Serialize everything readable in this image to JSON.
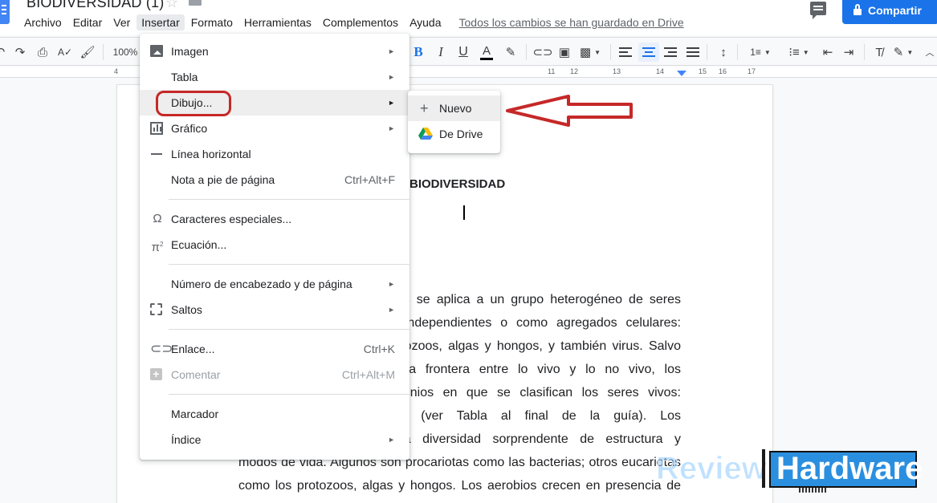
{
  "header": {
    "doc_title": "BIODIVERSIDAD (1)",
    "save_status": "Todos los cambios se han guardado en Drive",
    "share_label": "Compartir",
    "menus": [
      "Archivo",
      "Editar",
      "Ver",
      "Insertar",
      "Formato",
      "Herramientas",
      "Complementos",
      "Ayuda"
    ]
  },
  "toolbar": {
    "zoom": "100%"
  },
  "ruler": {
    "numbers": [
      "4",
      "11",
      "12",
      "13",
      "14",
      "15",
      "16",
      "17"
    ]
  },
  "insert_menu": {
    "items": [
      {
        "label": "Imagen",
        "icon": "image-icon",
        "submenu": true
      },
      {
        "label": "Tabla",
        "submenu": true
      },
      {
        "label": "Dibujo...",
        "submenu": true
      },
      {
        "label": "Gráfico",
        "icon": "chart-icon",
        "submenu": true
      },
      {
        "label": "Línea horizontal",
        "icon": "horizontal-line-icon"
      },
      {
        "label": "Nota a pie de página",
        "shortcut": "Ctrl+Alt+F"
      },
      {
        "label": "Caracteres especiales...",
        "icon": "omega-icon"
      },
      {
        "label": "Ecuación...",
        "icon": "pi-icon"
      },
      {
        "label": "Número de encabezado y de página",
        "submenu": true
      },
      {
        "label": "Saltos",
        "icon": "page-break-icon",
        "submenu": true
      },
      {
        "label": "Enlace...",
        "icon": "link-icon",
        "shortcut": "Ctrl+K"
      },
      {
        "label": "Comentar",
        "icon": "add-comment-icon",
        "shortcut": "Ctrl+Alt+M",
        "disabled": true
      },
      {
        "label": "Marcador"
      },
      {
        "label": "Índice",
        "submenu": true
      }
    ],
    "submenu_arrow": "►"
  },
  "drawing_submenu": {
    "items": [
      {
        "label": "Nuevo",
        "icon": "plus-icon"
      },
      {
        "label": "De Drive",
        "icon": "google-drive-icon"
      }
    ]
  },
  "document": {
    "heading": "BIODIVERSIDAD",
    "lines": [
      "nos se aplica a un grupo heterogéneo de seres",
      "s independientes o como agregados celulares:",
      "rotozoos, algas y hongos, y también virus. Salvo",
      "n la frontera entre lo vivo y lo no vivo, los",
      "ominios en que se clasifican los seres vivos:",
      "rya (ver Tabla al final de la guía). Los",
      "una diversidad sorprendente de estructura y",
      "modos de vida. Algunos son procariotas como las bacterias; otros eucariotas",
      "como los protozoos, algas y hongos. Los aerobios crecen en presencia de"
    ]
  },
  "watermark": {
    "left": "Review",
    "right": "Hardware"
  },
  "colors": {
    "accent": "#1a73e8",
    "annotation_red": "#c62828"
  }
}
